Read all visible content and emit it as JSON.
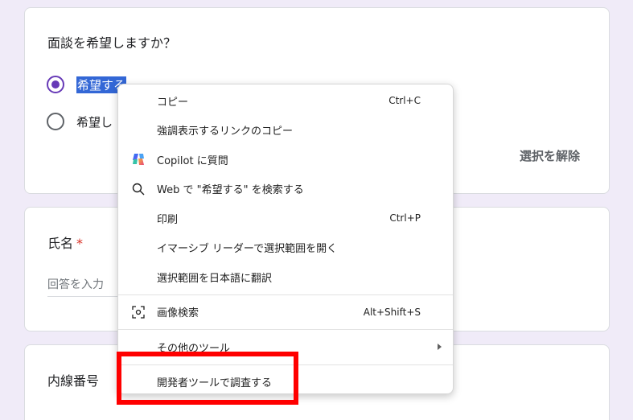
{
  "question1": {
    "title": "面談を希望しますか？",
    "options": [
      {
        "label": "希望する",
        "checked": true
      },
      {
        "label": "希望し"
      }
    ],
    "clear_label": "選択を解除"
  },
  "question2": {
    "title": "氏名",
    "required_mark": "*",
    "placeholder": "回答を入力"
  },
  "question3": {
    "title": "内線番号"
  },
  "context_menu": {
    "items": [
      {
        "label": "コピー",
        "shortcut": "Ctrl+C"
      },
      {
        "label": "強調表示するリンクのコピー"
      },
      {
        "label": "Copilot に質問",
        "icon": "copilot-icon"
      },
      {
        "label": "Web で \"希望する\" を検索する",
        "icon": "search-icon"
      },
      {
        "label": "印刷",
        "shortcut": "Ctrl+P"
      },
      {
        "label": "イマーシブ リーダーで選択範囲を開く"
      },
      {
        "label": "選択範囲を日本語に翻訳"
      },
      {
        "label": "画像検索",
        "shortcut": "Alt+Shift+S",
        "icon": "image-search-icon"
      },
      {
        "label": "その他のツール",
        "submenu": true
      },
      {
        "label": "開発者ツールで調査する"
      }
    ]
  },
  "colors": {
    "page_bg": "#f0ebf8",
    "accent": "#673ab7",
    "highlight": "#ff0000",
    "selection": "#3367d6"
  }
}
